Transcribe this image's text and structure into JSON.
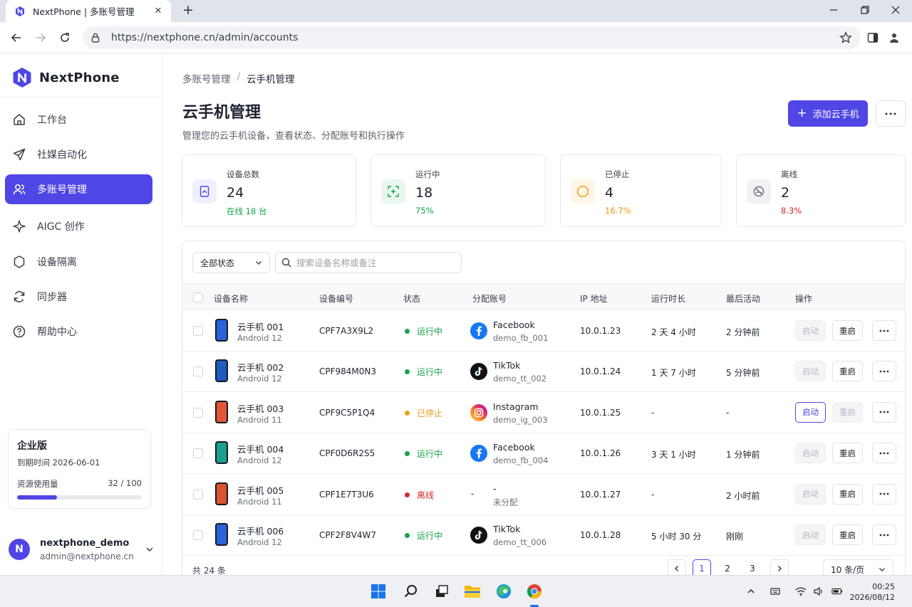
{
  "browser": {
    "tab_title": "NextPhone | 多账号管理",
    "url": "https://nextphone.cn/admin/accounts"
  },
  "sidebar": {
    "brand": "NextPhone",
    "items": [
      {
        "label": "工作台",
        "icon": "home-icon"
      },
      {
        "label": "社媒自动化",
        "icon": "send-icon"
      },
      {
        "label": "多账号管理",
        "icon": "users-icon",
        "active": true
      },
      {
        "label": "AIGC 创作",
        "icon": "sparkle-icon"
      },
      {
        "label": "设备隔离",
        "icon": "shield-icon"
      },
      {
        "label": "同步器",
        "icon": "sync-icon"
      },
      {
        "label": "帮助中心",
        "icon": "help-icon"
      }
    ],
    "plan": {
      "title": "企业版",
      "expiry": "到期时间 2026-06-01",
      "usage_label": "资源使用量",
      "usage_value": "32 / 100",
      "usage_fraction": 0.32
    },
    "user": {
      "initial": "N",
      "name": "nextphone_demo",
      "email": "admin@nextphone.cn"
    }
  },
  "header": {
    "breadcrumb": [
      "多账号管理",
      "云手机管理"
    ],
    "title": "云手机管理",
    "subtitle": "管理您的云手机设备，查看状态、分配账号和执行操作",
    "add_button": "添加云手机"
  },
  "stats": [
    {
      "label": "设备总数",
      "value": "24",
      "sub": "在线 18 台",
      "sub_color": "#16a34a",
      "icon": "device-icon",
      "icon_bg": "#eef0ff",
      "icon_color": "#4f46e5"
    },
    {
      "label": "运行中",
      "value": "18",
      "sub": "75%",
      "sub_color": "#16a34a",
      "icon": "running-icon",
      "icon_bg": "#e9f8ef",
      "icon_color": "#16a34a"
    },
    {
      "label": "已停止",
      "value": "4",
      "sub": "16.7%",
      "sub_color": "#e6960a",
      "icon": "stopped-icon",
      "icon_bg": "#fff5e6",
      "icon_color": "#f29b1b"
    },
    {
      "label": "离线",
      "value": "2",
      "sub": "8.3%",
      "sub_color": "#dc2626",
      "icon": "offline-icon",
      "icon_bg": "#f0f1f4",
      "icon_color": "#6b707c"
    }
  ],
  "filters": {
    "status_select": "全部状态",
    "search_placeholder": "搜索设备名称或备注"
  },
  "table": {
    "columns": [
      "设备名称",
      "设备编号",
      "状态",
      "分配账号",
      "IP 地址",
      "运行时长",
      "最后活动",
      "操作"
    ],
    "action_start": "启动",
    "action_restart": "重启",
    "rows": [
      {
        "name": "云手机 001",
        "os": "Android 12",
        "screen": "#2a63d9",
        "code": "CPF7A3X9L2",
        "status": "运行中",
        "status_color": "#16a34a",
        "platform": "Facebook",
        "account": "demo_fb_001",
        "platform_icon": "facebook-icon",
        "ip": "10.0.1.23",
        "uptime": "2 天 4 小时",
        "last": "2 分钟前",
        "start_state": "disabled",
        "restart_state": "normal"
      },
      {
        "name": "云手机 002",
        "os": "Android 12",
        "screen": "#1f5cbf",
        "code": "CPF984M0N3",
        "status": "运行中",
        "status_color": "#16a34a",
        "platform": "TikTok",
        "account": "demo_tt_002",
        "platform_icon": "tiktok-icon",
        "ip": "10.0.1.24",
        "uptime": "1 天 7 小时",
        "last": "5 分钟前",
        "start_state": "disabled",
        "restart_state": "normal"
      },
      {
        "name": "云手机 003",
        "os": "Android 11",
        "screen": "#e2573a",
        "code": "CPF9C5P1Q4",
        "status": "已停止",
        "status_color": "#f29b1b",
        "platform": "Instagram",
        "account": "demo_ig_003",
        "platform_icon": "instagram-icon",
        "ip": "10.0.1.25",
        "uptime": "-",
        "last": "-",
        "start_state": "primary",
        "restart_state": "disabled"
      },
      {
        "name": "云手机 004",
        "os": "Android 12",
        "screen": "#1c9f8f",
        "code": "CPF0D6R2S5",
        "status": "运行中",
        "status_color": "#16a34a",
        "platform": "Facebook",
        "account": "demo_fb_004",
        "platform_icon": "facebook-icon",
        "ip": "10.0.1.26",
        "uptime": "3 天 1 小时",
        "last": "1 分钟前",
        "start_state": "disabled",
        "restart_state": "normal"
      },
      {
        "name": "云手机 005",
        "os": "Android 11",
        "screen": "#d9542f",
        "code": "CPF1E7T3U6",
        "status": "离线",
        "status_color": "#dc2626",
        "platform": "-",
        "account": "未分配",
        "platform_icon": "",
        "ip": "10.0.1.27",
        "uptime": "-",
        "last": "2 小时前",
        "start_state": "disabled",
        "restart_state": "normal"
      },
      {
        "name": "云手机 006",
        "os": "Android 12",
        "screen": "#2a63d9",
        "code": "CPF2F8V4W7",
        "status": "运行中",
        "status_color": "#16a34a",
        "platform": "TikTok",
        "account": "demo_tt_006",
        "platform_icon": "tiktok-icon",
        "ip": "10.0.1.28",
        "uptime": "5 小时 30 分",
        "last": "刚刚",
        "start_state": "disabled",
        "restart_state": "normal"
      }
    ]
  },
  "pagination": {
    "total": "共 24 条",
    "pages": [
      "1",
      "2",
      "3"
    ],
    "current": "1",
    "page_size": "10 条/页"
  },
  "taskbar": {
    "time": "00:25",
    "date": "2026/08/12"
  },
  "colors": {
    "accent": "#4f46e5",
    "success": "#16a34a",
    "warning": "#f29b1b",
    "danger": "#dc2626"
  }
}
